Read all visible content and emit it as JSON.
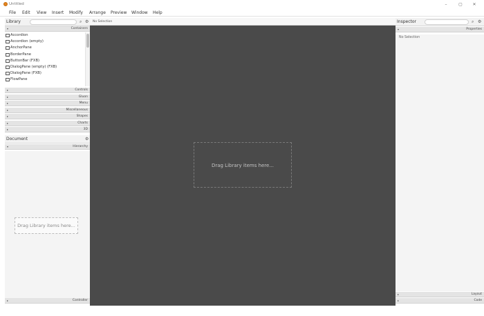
{
  "window": {
    "title": "Untitled",
    "controls": {
      "minimize": "–",
      "maximize": "▢",
      "close": "✕"
    }
  },
  "menu": [
    "File",
    "Edit",
    "View",
    "Insert",
    "Modify",
    "Arrange",
    "Preview",
    "Window",
    "Help"
  ],
  "library": {
    "title": "Library",
    "search_placeholder": "",
    "sections": {
      "open": "Containers",
      "collapsed": [
        "Controls",
        "Gluon",
        "Menu",
        "Miscellaneous",
        "Shapes",
        "Charts",
        "3D"
      ]
    },
    "items": [
      "Accordion",
      "Accordion  (empty)",
      "AnchorPane",
      "BorderPane",
      "ButtonBar  (FXB)",
      "DialogPane (empty)  (FXB)",
      "DialogPane  (FXB)",
      "FlowPane"
    ]
  },
  "document": {
    "title": "Document",
    "sections": {
      "hierarchy": "Hierarchy",
      "controller": "Controller"
    },
    "drop_hint": "Drag Library items here..."
  },
  "canvas": {
    "breadcrumb": "No Selection",
    "drop_hint": "Drag Library items here..."
  },
  "inspector": {
    "title": "Inspector",
    "search_placeholder": "",
    "sections": {
      "properties": "Properties",
      "layout": "Layout",
      "code": "Code"
    },
    "no_selection": "No Selection"
  },
  "colors": {
    "canvas_bg": "#4a4a4a",
    "panel_bg": "#f4f4f4",
    "section_bar": "#e4e4e4",
    "app_icon": "#e5851e"
  }
}
